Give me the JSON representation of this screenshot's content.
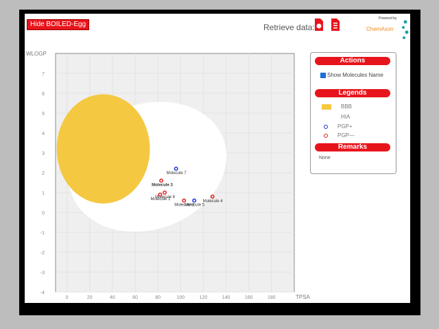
{
  "toolbar": {
    "hide_button_label": "Hide BOILED-Egg",
    "retrieve_label": "Retrieve data:",
    "logo_small": "Powered by",
    "logo_text": "ChemAxon"
  },
  "sidebar": {
    "actions_header": "Actions",
    "show_names_label": "Show Molecules Name",
    "legends_header": "Legends",
    "legend_items": [
      {
        "label": "BBB",
        "color": "#f5c842"
      },
      {
        "label": "HIA",
        "color": "#ffffff"
      },
      {
        "label": "PGP+",
        "color": "#1a2fd8"
      },
      {
        "label": "PGP—",
        "color": "#e01b1b"
      }
    ],
    "remarks_header": "Remarks",
    "remarks_value": "None"
  },
  "chart_data": {
    "type": "scatter",
    "xlabel": "TPSA",
    "ylabel": "WLOGP",
    "xlim": [
      -10,
      200
    ],
    "ylim": [
      -4,
      8
    ],
    "xticks": [
      0,
      20,
      40,
      60,
      80,
      100,
      120,
      140,
      160,
      180
    ],
    "yticks": [
      -4,
      -3,
      -2,
      -1,
      0,
      1,
      2,
      3,
      4,
      5,
      6,
      7
    ],
    "grid": true,
    "colors": {
      "bbb": "#f5c842",
      "hia": "#ffffff",
      "pgp_plus": "#1a2fd8",
      "pgp_minus": "#e01b1b",
      "plot_bg": "#efefef"
    },
    "points": [
      {
        "name": "Molecule 7",
        "tpsa": 96,
        "wlogp": 2.2,
        "pgp": "+",
        "bold": false
      },
      {
        "name": "Molecule 3",
        "tpsa": 83,
        "wlogp": 1.6,
        "pgp": "-",
        "bold": true
      },
      {
        "name": "Molecule 6",
        "tpsa": 86,
        "wlogp": 1.0,
        "pgp": "-",
        "bold": false
      },
      {
        "name": "Molecule 1",
        "tpsa": 82,
        "wlogp": 0.9,
        "pgp": "-",
        "bold": false
      },
      {
        "name": "Molecule 2",
        "tpsa": 103,
        "wlogp": 0.6,
        "pgp": "-",
        "bold": false
      },
      {
        "name": "Molecule 5",
        "tpsa": 112,
        "wlogp": 0.6,
        "pgp": "+",
        "bold": false
      },
      {
        "name": "Molecule 4",
        "tpsa": 128,
        "wlogp": 0.8,
        "pgp": "-",
        "bold": false
      }
    ]
  }
}
